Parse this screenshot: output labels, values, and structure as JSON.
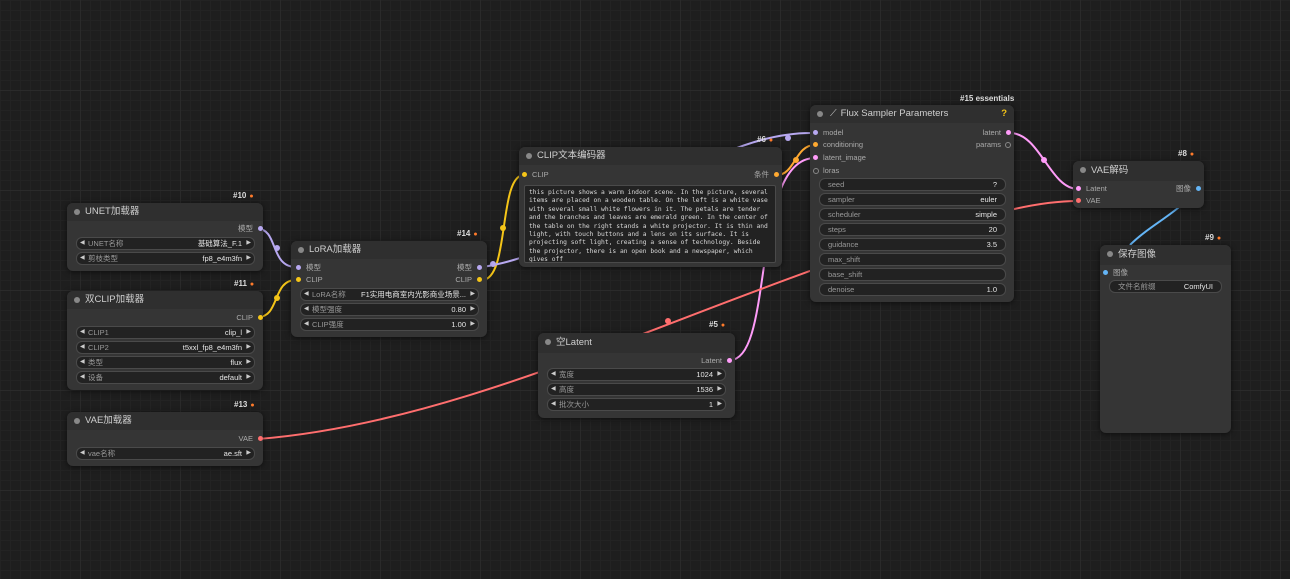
{
  "colors": {
    "clip": "#f5c518",
    "model": "#b7a8f0",
    "vae": "#ff6e6e",
    "latent": "#ff9cf9",
    "conditioning": "#ffa931",
    "image": "#64b5f6"
  },
  "nodes": {
    "unet_loader": {
      "id": "#10",
      "title": "UNET加载器",
      "output_model": "模型",
      "w_unet_label": "UNET名称",
      "w_unet_value": "基础算法_F.1",
      "w_dtype_label": "剪枝类型",
      "w_dtype_value": "fp8_e4m3fn"
    },
    "dual_clip": {
      "id": "#11",
      "title": "双CLIP加载器",
      "output_clip": "CLIP",
      "w_clip1_label": "CLIP1",
      "w_clip1_value": "clip_l",
      "w_clip2_label": "CLIP2",
      "w_clip2_value": "t5xxl_fp8_e4m3fn",
      "w_type_label": "类型",
      "w_type_value": "flux",
      "w_device_label": "设备",
      "w_device_value": "default"
    },
    "vae_loader": {
      "id": "#13",
      "title": "VAE加载器",
      "output_vae": "VAE",
      "w_vae_label": "vae名称",
      "w_vae_value": "ae.sft"
    },
    "lora_loader": {
      "id": "#14",
      "title": "LoRA加载器",
      "input_model": "模型",
      "input_clip": "CLIP",
      "output_model": "模型",
      "output_clip": "CLIP",
      "w_lora_label": "LoRA名称",
      "w_lora_value": "F1实用电商室内光影商业场景...",
      "w_model_str_label": "模型强度",
      "w_model_str_value": "0.80",
      "w_clip_str_label": "CLIP强度",
      "w_clip_str_value": "1.00"
    },
    "clip_text": {
      "id": "#6",
      "title": "CLIP文本编码器",
      "input_clip": "CLIP",
      "output_cond": "条件",
      "text": "this picture shows a warm indoor scene. In the picture, several items are placed on a wooden table. On the left is a white vase with several small white flowers in it. The petals are tender and the branches and leaves are emerald green. In the center of the table on the right stands a white projector. It is thin and light, with touch buttons and a lens on its surface. It is projecting soft light, creating a sense of technology. Beside the projector, there is an open book and a newspaper, which gives off"
    },
    "empty_latent": {
      "id": "#5",
      "title": "空Latent",
      "output_latent": "Latent",
      "w_width_label": "宽度",
      "w_width_value": "1024",
      "w_height_label": "高度",
      "w_height_value": "1536",
      "w_batch_label": "批次大小",
      "w_batch_value": "1"
    },
    "flux_sampler": {
      "id": "#15 essentials",
      "title": "Flux Sampler Parameters",
      "help": "?",
      "input_model": "model",
      "input_conditioning": "conditioning",
      "input_latent": "latent_image",
      "input_loras": "loras",
      "output_latent": "latent",
      "output_params": "params",
      "w_seed_label": "seed",
      "w_seed_value": "?",
      "w_sampler_label": "sampler",
      "w_sampler_value": "euler",
      "w_scheduler_label": "scheduler",
      "w_scheduler_value": "simple",
      "w_steps_label": "steps",
      "w_steps_value": "20",
      "w_guidance_label": "guidance",
      "w_guidance_value": "3.5",
      "w_max_shift_label": "max_shift",
      "w_max_shift_value": "",
      "w_base_shift_label": "base_shift",
      "w_base_shift_value": "",
      "w_denoise_label": "denoise",
      "w_denoise_value": "1.0"
    },
    "vae_decode": {
      "id": "#8",
      "title": "VAE解码",
      "input_latent": "Latent",
      "input_vae": "VAE",
      "output_image": "图像"
    },
    "save_image": {
      "id": "#9",
      "title": "保存图像",
      "input_images": "图像",
      "w_prefix_label": "文件名前缀",
      "w_prefix_value": "ComfyUI"
    }
  }
}
